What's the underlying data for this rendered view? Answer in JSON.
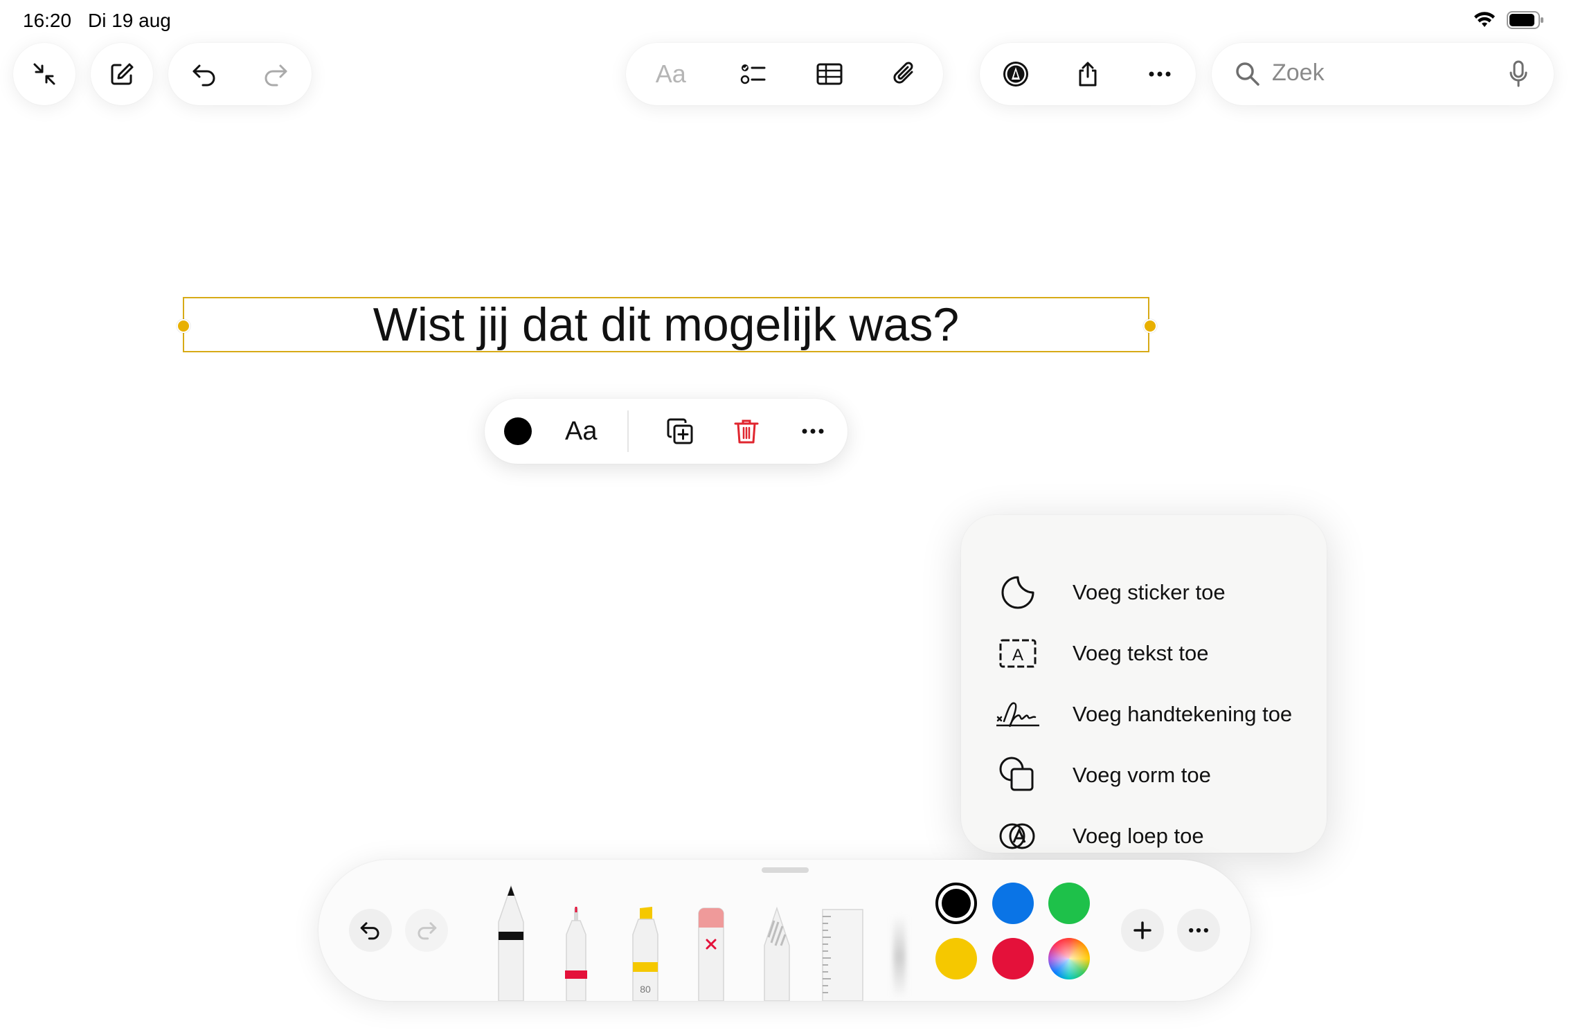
{
  "status_bar": {
    "time": "16:20",
    "date": "Di 19 aug"
  },
  "top_toolbar": {
    "format_label": "Aa",
    "search": {
      "placeholder": "Zoek"
    }
  },
  "canvas": {
    "text": "Wist jij dat dit mogelijk was?"
  },
  "context_toolbar": {
    "font_label": "Aa"
  },
  "add_menu": {
    "items": [
      {
        "label": "Voeg sticker toe",
        "icon": "sticker-icon"
      },
      {
        "label": "Voeg tekst toe",
        "icon": "text-box-icon"
      },
      {
        "label": "Voeg handtekening toe",
        "icon": "signature-icon"
      },
      {
        "label": "Voeg vorm toe",
        "icon": "shapes-icon"
      },
      {
        "label": "Voeg loep toe",
        "icon": "magnifier-icon"
      }
    ]
  },
  "palette": {
    "tools": [
      "pen",
      "fineliner",
      "highlighter",
      "eraser",
      "pencil",
      "ruler"
    ],
    "highlighter_label": "80",
    "colors": [
      {
        "name": "black",
        "hex": "#000000",
        "selected": true
      },
      {
        "name": "blue",
        "hex": "#0a74e6"
      },
      {
        "name": "green",
        "hex": "#1ec14a"
      },
      {
        "name": "yellow",
        "hex": "#f5c800"
      },
      {
        "name": "red",
        "hex": "#e4113a"
      },
      {
        "name": "multicolor",
        "hex": "conic"
      }
    ]
  },
  "colors": {
    "selection": "#d7aa16",
    "delete": "#e0262f"
  }
}
